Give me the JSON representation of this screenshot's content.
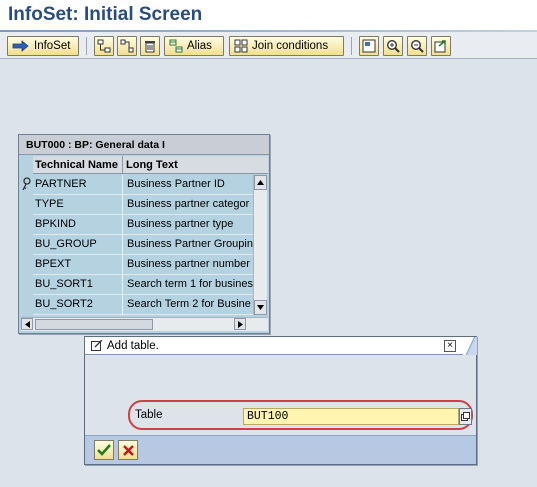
{
  "window": {
    "title": "InfoSet: Initial Screen"
  },
  "toolbar": {
    "infoset_label": "InfoSet",
    "alias_label": "Alias",
    "join_conditions_label": "Join conditions"
  },
  "table_window": {
    "title": "BUT000 : BP: General data I",
    "columns": [
      "Technical Name",
      "Long Text"
    ],
    "rows": [
      {
        "name": "PARTNER",
        "text": "Business Partner ID",
        "key": true
      },
      {
        "name": "TYPE",
        "text": "Business partner categor"
      },
      {
        "name": "BPKIND",
        "text": "Business partner type"
      },
      {
        "name": "BU_GROUP",
        "text": "Business Partner Groupin"
      },
      {
        "name": "BPEXT",
        "text": "Business partner number"
      },
      {
        "name": "BU_SORT1",
        "text": "Search term 1 for busines"
      },
      {
        "name": "BU_SORT2",
        "text": "Search Term 2 for Busine"
      }
    ]
  },
  "dialog": {
    "title": "Add table.",
    "close_glyph": "×",
    "table_label": "Table",
    "table_value": "BUT100"
  },
  "colors": {
    "title_text": "#2a4d7e",
    "button_gradient_top": "#fffde4",
    "button_gradient_bottom": "#f1df8d",
    "table_bg": "#b5d2e0",
    "input_bg": "#fff4b0",
    "highlight_ring": "#cf4040"
  }
}
